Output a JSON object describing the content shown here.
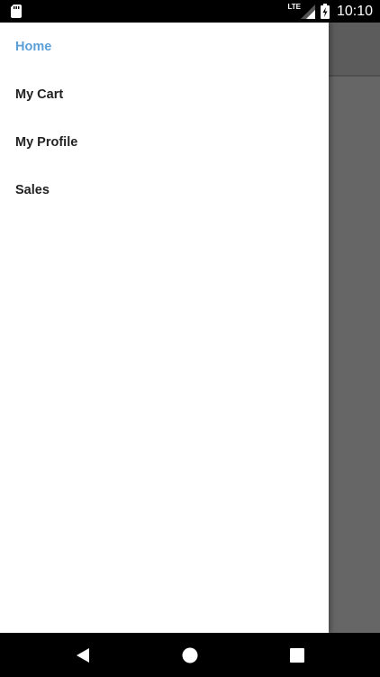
{
  "status_bar": {
    "network": "LTE",
    "time": "10:10",
    "icons": [
      "sim-card-icon",
      "signal-icon",
      "battery-charging-icon"
    ]
  },
  "drawer": {
    "items": [
      {
        "label": "Home",
        "active": true
      },
      {
        "label": "My Cart",
        "active": false
      },
      {
        "label": "My Profile",
        "active": false
      },
      {
        "label": "Sales",
        "active": false
      }
    ],
    "active_color": "#5b9fd8",
    "text_color": "#222222"
  },
  "nav_bar": {
    "buttons": [
      "back-icon",
      "home-icon",
      "recents-icon"
    ]
  }
}
